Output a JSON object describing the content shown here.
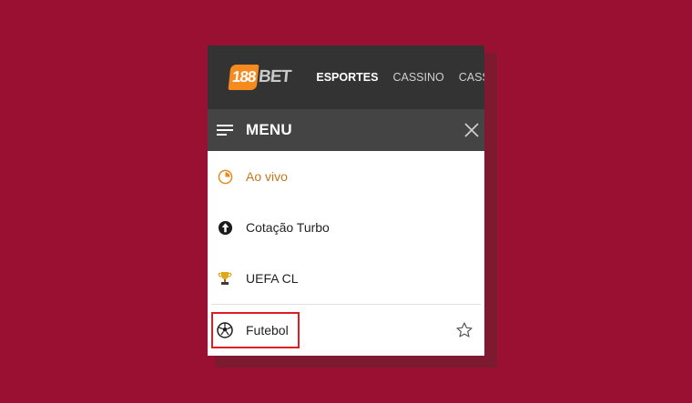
{
  "brand": {
    "badge": "188",
    "text": "BET",
    "accent": "#f58a1f"
  },
  "nav": [
    {
      "label": "ESPORTES",
      "active": true
    },
    {
      "label": "CASSINO",
      "active": false
    },
    {
      "label": "CASSINO",
      "active": false
    }
  ],
  "menu": {
    "title": "MENU"
  },
  "items": [
    {
      "label": "Ao vivo",
      "icon": "live-clock-icon"
    },
    {
      "label": "Cotação Turbo",
      "icon": "turbo-arrow-icon"
    },
    {
      "label": "UEFA CL",
      "icon": "trophy-icon"
    }
  ],
  "favorite": {
    "label": "Futebol",
    "icon": "soccer-ball-icon",
    "star_icon": "star-outline-icon",
    "highlight_color": "#e11b22"
  }
}
